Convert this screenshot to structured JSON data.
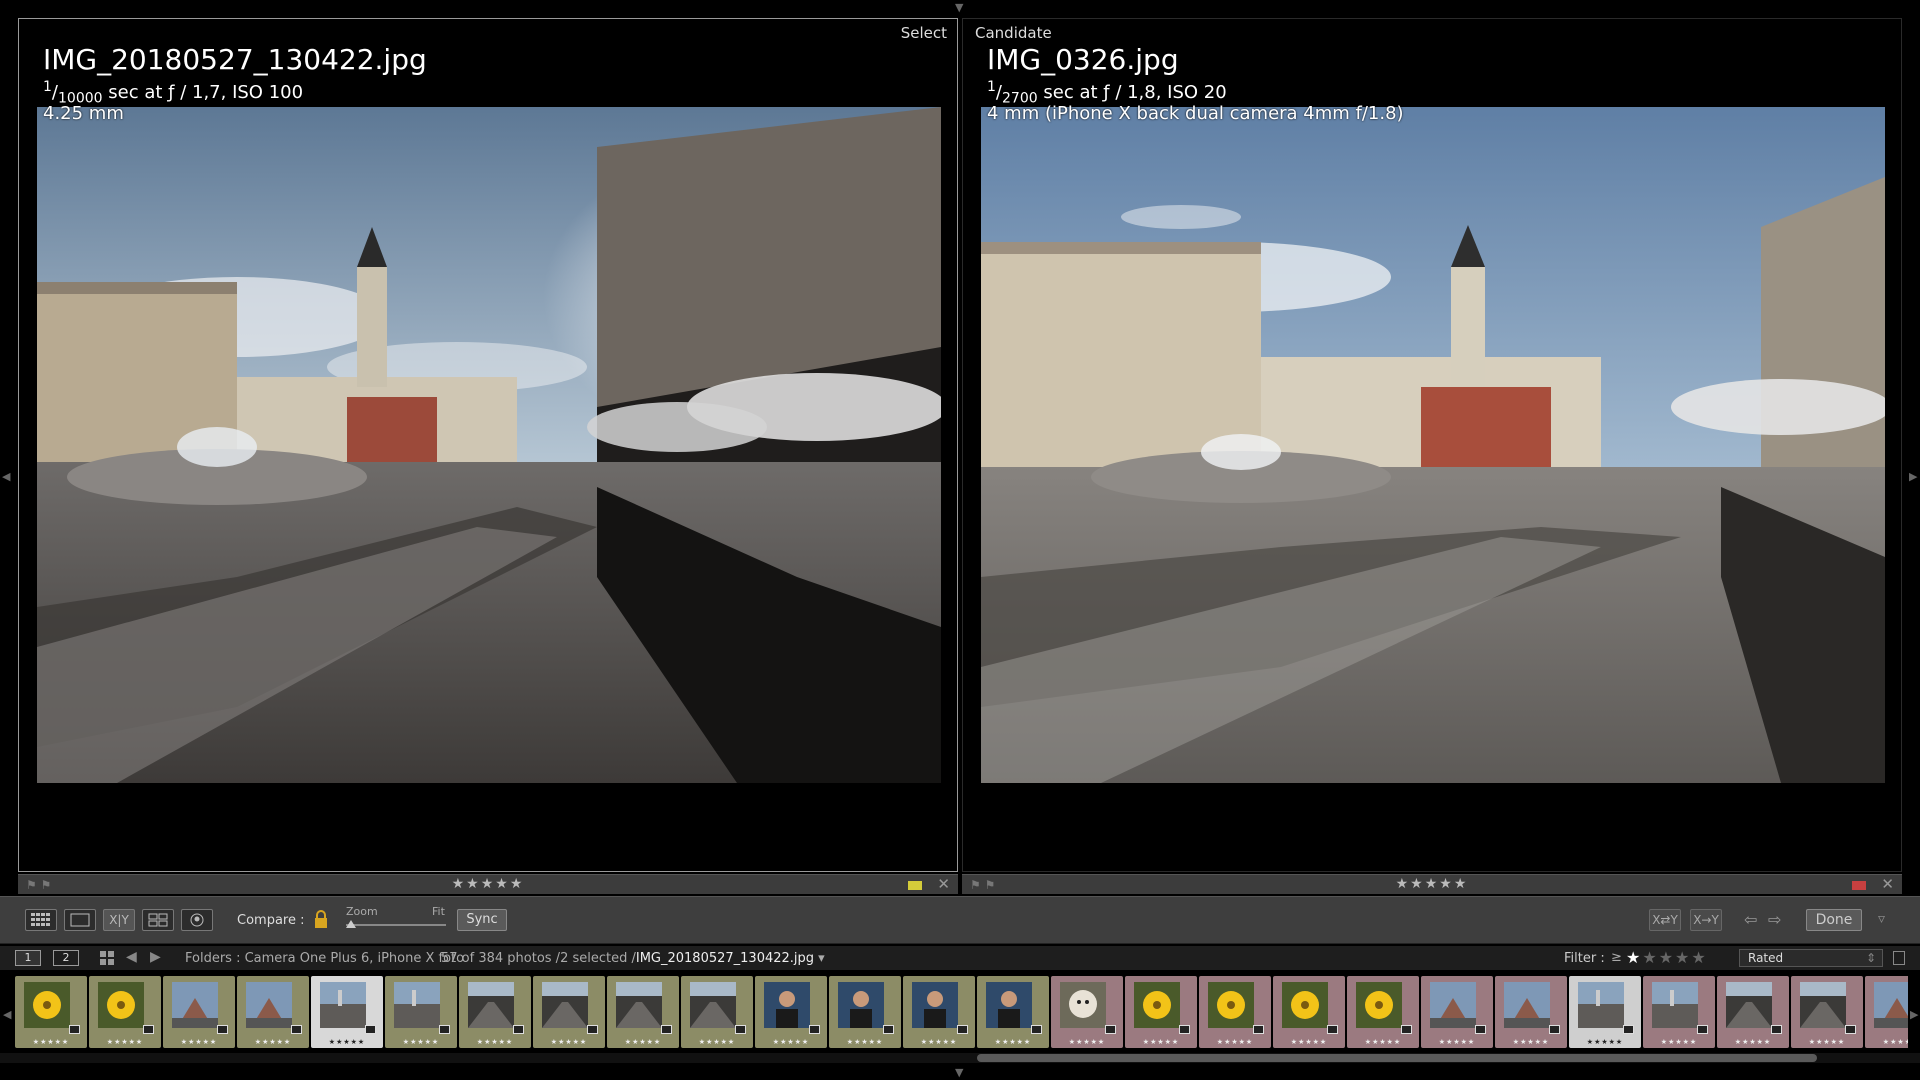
{
  "left_pane": {
    "tag": "Select",
    "filename": "IMG_20180527_130422.jpg",
    "shutter_num": "1",
    "shutter_den": "10000",
    "exposure": "sec at ƒ / 1,7, ISO 100",
    "focal": "4.25 mm",
    "stars": "★★★★★",
    "label_color": "#d4cc3a"
  },
  "right_pane": {
    "tag": "Candidate",
    "filename": "IMG_0326.jpg",
    "shutter_num": "1",
    "shutter_den": "2700",
    "exposure": "sec at ƒ / 1,8, ISO 20",
    "focal": "4 mm (iPhone X back dual camera 4mm f/1.8)",
    "stars": "★★★★★",
    "label_color": "#c84040"
  },
  "toolbar": {
    "compare_label": "Compare :",
    "zoom_label": "Zoom",
    "fit_label": "Fit",
    "sync_label": "Sync",
    "done_label": "Done",
    "xy_label": "X|Y",
    "swap_a": "X⇄Y",
    "swap_b": "X→Y"
  },
  "filmstrip_header": {
    "monitor_1": "1",
    "monitor_2": "2",
    "source": "Folders : Camera One Plus 6, iPhone X foto",
    "count": "57 of 384 photos /2 selected /",
    "current_file": "IMG_20180527_130422.jpg",
    "filter_label": "Filter :",
    "filter_op": "≥",
    "filter_stars": "★★★★★",
    "filter_value": "Rated"
  },
  "filmstrip": {
    "thumbnails": [
      {
        "subject": "yellow-flower",
        "label": "olive",
        "stars": "★★★★★"
      },
      {
        "subject": "yellow-flower",
        "label": "olive",
        "stars": "★★★★★"
      },
      {
        "subject": "street-scene",
        "label": "olive",
        "stars": "★★★★★"
      },
      {
        "subject": "street-scene",
        "label": "olive",
        "stars": "★★★★★"
      },
      {
        "subject": "town-square",
        "label": "selected",
        "stars": "★★★★★"
      },
      {
        "subject": "town-square",
        "label": "olive",
        "stars": "★★★★★"
      },
      {
        "subject": "dark-street",
        "label": "olive",
        "stars": "★★★★★"
      },
      {
        "subject": "dark-street",
        "label": "olive",
        "stars": "★★★★★"
      },
      {
        "subject": "dark-street",
        "label": "olive",
        "stars": "★★★★★"
      },
      {
        "subject": "dark-street",
        "label": "olive",
        "stars": "★★★★★"
      },
      {
        "subject": "portrait",
        "label": "olive",
        "stars": "★★★★★"
      },
      {
        "subject": "portrait",
        "label": "olive",
        "stars": "★★★★★"
      },
      {
        "subject": "portrait",
        "label": "olive",
        "stars": "★★★★★"
      },
      {
        "subject": "portrait",
        "label": "olive",
        "stars": "★★★★★"
      },
      {
        "subject": "dog",
        "label": "rose",
        "stars": "★★★★★"
      },
      {
        "subject": "yellow-flower",
        "label": "rose",
        "stars": "★★★★★"
      },
      {
        "subject": "yellow-flower",
        "label": "rose",
        "stars": "★★★★★"
      },
      {
        "subject": "yellow-flower",
        "label": "rose",
        "stars": "★★★★★"
      },
      {
        "subject": "yellow-flower",
        "label": "rose",
        "stars": "★★★★★"
      },
      {
        "subject": "street-scene",
        "label": "rose",
        "stars": "★★★★★"
      },
      {
        "subject": "street-scene",
        "label": "rose",
        "stars": "★★★★★"
      },
      {
        "subject": "town-square",
        "label": "candidate",
        "stars": "★★★★★"
      },
      {
        "subject": "town-square",
        "label": "rose",
        "stars": "★★★★★"
      },
      {
        "subject": "dark-street",
        "label": "rose",
        "stars": "★★★★★"
      },
      {
        "subject": "dark-street",
        "label": "rose",
        "stars": "★★★★★"
      },
      {
        "subject": "street-scene",
        "label": "rose",
        "stars": "★★★★★"
      }
    ]
  },
  "colors": {
    "accent_selected_label": "#d4cc3a",
    "accent_candidate_label": "#c84040",
    "olive_cell": "#8c8c66",
    "rose_cell": "#9b7a80"
  }
}
